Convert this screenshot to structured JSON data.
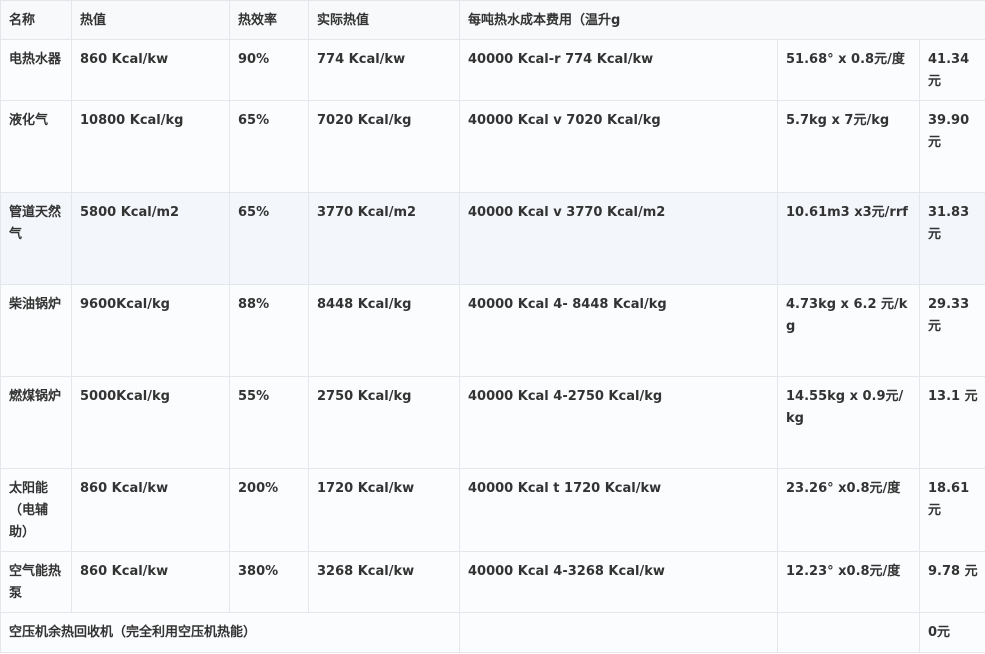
{
  "table": {
    "headers": [
      "名称",
      "热值",
      "热效率",
      "实际热值",
      "每吨热水成本费用（温升g"
    ],
    "rows": [
      {
        "name": "电热水器",
        "heat": "860 Kcal/kw",
        "eff": "90%",
        "actual": "774 Kcal/kw",
        "calc": "40000 Kcal-r 774 Kcal/kw",
        "unit": "51.68° x 0.8元/度",
        "cost": "41.34元"
      },
      {
        "name": "液化气",
        "heat": "10800 Kcal/kg",
        "eff": "65%",
        "actual": "7020 Kcal/kg",
        "calc": "40000 Kcal v 7020 Kcal/kg",
        "unit": "5.7kg x 7元/kg",
        "cost": "39.90元"
      },
      {
        "name": "管道天然气",
        "heat": "5800 Kcal/m2",
        "eff": "65%",
        "actual": "3770 Kcal/m2",
        "calc": "40000 Kcal v 3770 Kcal/m2",
        "unit": "10.61m3 x3元/rrf",
        "cost": "31.83元"
      },
      {
        "name": "柴油锅炉",
        "heat": "9600Kcal/kg",
        "eff": "88%",
        "actual": "8448 Kcal/kg",
        "calc": "40000 Kcal 4- 8448 Kcal/kg",
        "unit": "4.73kg x 6.2 元/kg",
        "cost": "29.33元"
      },
      {
        "name": "燃煤锅炉",
        "heat": "5000Kcal/kg",
        "eff": "55%",
        "actual": "2750 Kcal/kg",
        "calc": "40000 Kcal 4-2750 Kcal/kg",
        "unit": "14.55kg x 0.9元/kg",
        "cost": "13.1 元"
      },
      {
        "name": "太阳能（电辅助）",
        "heat": "860 Kcal/kw",
        "eff": "200%",
        "actual": "1720 Kcal/kw",
        "calc": "40000 Kcal t 1720 Kcal/kw",
        "unit": "23.26° x0.8元/度",
        "cost": "18.61元"
      },
      {
        "name": "空气能热泵",
        "heat": "860 Kcal/kw",
        "eff": "380%",
        "actual": "3268 Kcal/kw",
        "calc": "40000 Kcal 4-3268 Kcal/kw",
        "unit": "12.23° x0.8元/度",
        "cost": "9.78 元"
      }
    ],
    "footer": {
      "label": "空压机余热回收机（完全利用空压机热能）",
      "cost": "0元"
    }
  }
}
